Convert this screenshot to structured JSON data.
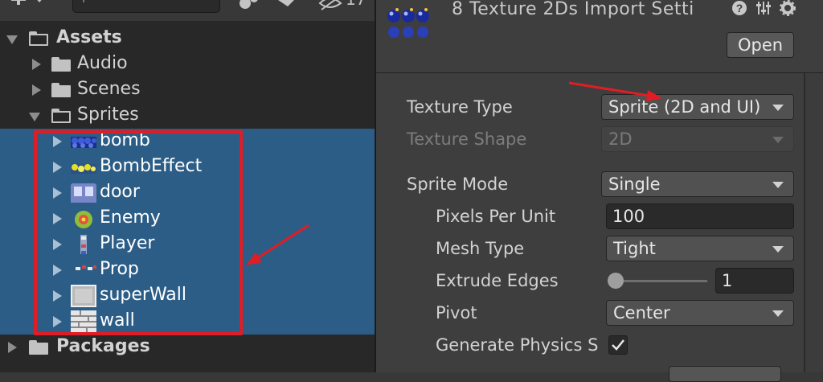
{
  "project": {
    "toolbar": {
      "add_icon": "plus-dropdown-icon",
      "search_placeholder": "",
      "hidden_count": "17"
    },
    "tree": [
      {
        "label": "Assets",
        "bold": true,
        "expanded": true,
        "level": 0
      },
      {
        "label": "Audio",
        "bold": false,
        "expanded": false,
        "level": 1
      },
      {
        "label": "Scenes",
        "bold": false,
        "expanded": false,
        "level": 1
      },
      {
        "label": "Sprites",
        "bold": false,
        "expanded": true,
        "level": 1
      }
    ],
    "sprites": [
      {
        "label": "bomb",
        "icon": "bomb-sprite-icon"
      },
      {
        "label": "BombEffect",
        "icon": "bomb-effect-sprite-icon"
      },
      {
        "label": "door",
        "icon": "door-sprite-icon"
      },
      {
        "label": "Enemy",
        "icon": "enemy-sprite-icon"
      },
      {
        "label": "Player",
        "icon": "player-sprite-icon"
      },
      {
        "label": "Prop",
        "icon": "prop-sprite-icon"
      },
      {
        "label": "superWall",
        "icon": "superwall-sprite-icon"
      },
      {
        "label": "wall",
        "icon": "wall-sprite-icon"
      }
    ],
    "packages": {
      "label": "Packages"
    }
  },
  "inspector": {
    "title": "8 Texture 2Ds Import Setti",
    "open_button": "Open",
    "fields": {
      "texture_type": {
        "label": "Texture Type",
        "value": "Sprite (2D and UI)"
      },
      "texture_shape": {
        "label": "Texture Shape",
        "value": "2D"
      },
      "sprite_mode": {
        "label": "Sprite Mode",
        "value": "Single"
      },
      "pixels_per_unit": {
        "label": "Pixels Per Unit",
        "value": "100"
      },
      "mesh_type": {
        "label": "Mesh Type",
        "value": "Tight"
      },
      "extrude_edges": {
        "label": "Extrude Edges",
        "value": "1"
      },
      "pivot": {
        "label": "Pivot",
        "value": "Center"
      },
      "generate_physics": {
        "label": "Generate Physics S",
        "checked": true
      }
    }
  },
  "colors": {
    "selection": "#2c5d87",
    "annotation": "#e01d25",
    "panel": "#282828",
    "inspector": "#3e3e3e"
  }
}
